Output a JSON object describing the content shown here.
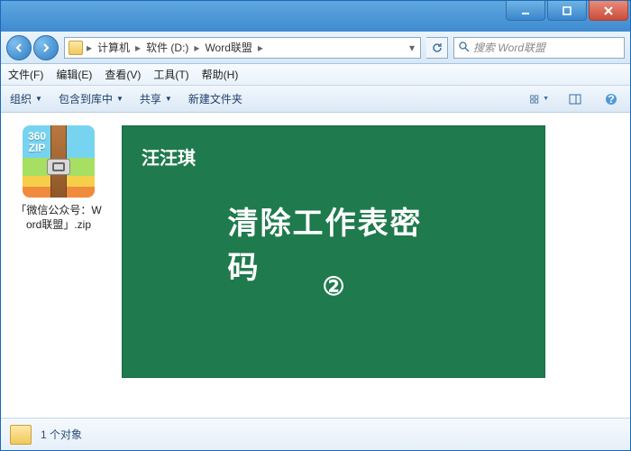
{
  "titlebar": {},
  "address": {
    "crumbs": [
      "计算机",
      "软件 (D:)",
      "Word联盟"
    ]
  },
  "search": {
    "placeholder": "搜索 Word联盟"
  },
  "menubar": {
    "file": "文件(F)",
    "edit": "编辑(E)",
    "view": "查看(V)",
    "tools": "工具(T)",
    "help": "帮助(H)"
  },
  "toolbar": {
    "organize": "组织",
    "include": "包含到库中",
    "share": "共享",
    "newfolder": "新建文件夹"
  },
  "files": {
    "zip_badge_top": "360",
    "zip_badge_bot": "ZIP",
    "zip_name": "「微信公众号：Word联盟」.zip"
  },
  "preview": {
    "author": "汪汪琪",
    "title": "清除工作表密码",
    "number": "②"
  },
  "status": {
    "text": "1 个对象"
  }
}
